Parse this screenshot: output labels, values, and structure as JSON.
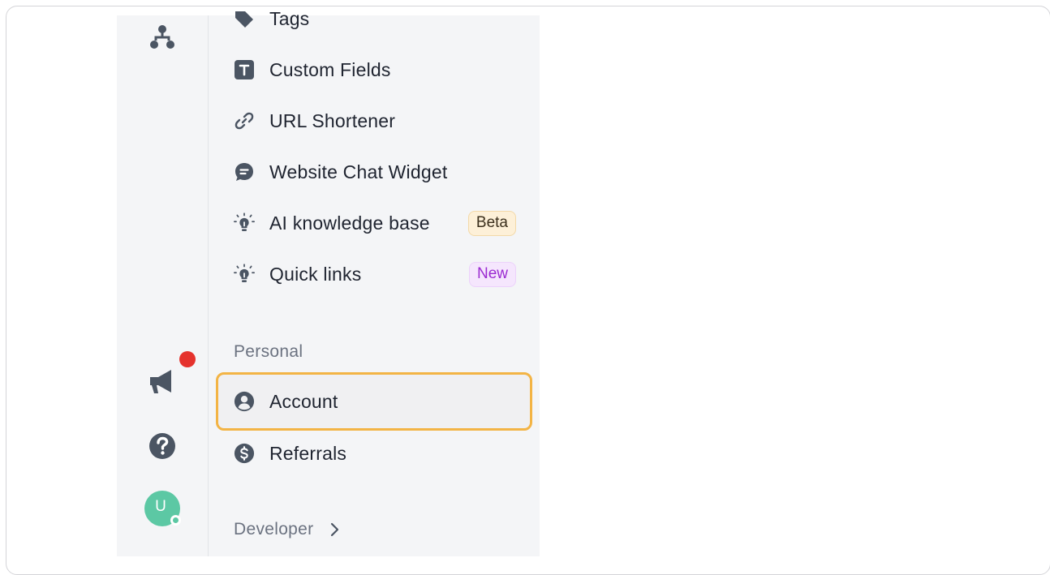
{
  "menu": {
    "items": [
      {
        "label": "Tags",
        "icon": "tag-icon"
      },
      {
        "label": "Custom Fields",
        "icon": "custom-fields-icon"
      },
      {
        "label": "URL Shortener",
        "icon": "link-icon"
      },
      {
        "label": "Website Chat Widget",
        "icon": "chat-bubble-icon"
      },
      {
        "label": "AI knowledge base",
        "icon": "lightbulb-icon",
        "badge": "Beta"
      },
      {
        "label": "Quick links",
        "icon": "lightbulb-icon",
        "badge": "New"
      }
    ],
    "personal": {
      "title": "Personal",
      "items": [
        {
          "label": "Account",
          "icon": "user-circle-icon",
          "highlighted": true
        },
        {
          "label": "Referrals",
          "icon": "dollar-circle-icon"
        }
      ]
    },
    "developer": {
      "title": "Developer",
      "icon": "chevron-right-icon"
    }
  },
  "rail": {
    "icons": [
      "hierarchy-icon",
      "megaphone-icon",
      "help-icon",
      "avatar"
    ],
    "avatar_initial": "U",
    "avatar_color": "#5cc8a4",
    "notification_color": "#e5322d"
  },
  "colors": {
    "highlight_border": "#f3b445",
    "icon": "#4b5563",
    "text": "#1f2430"
  }
}
